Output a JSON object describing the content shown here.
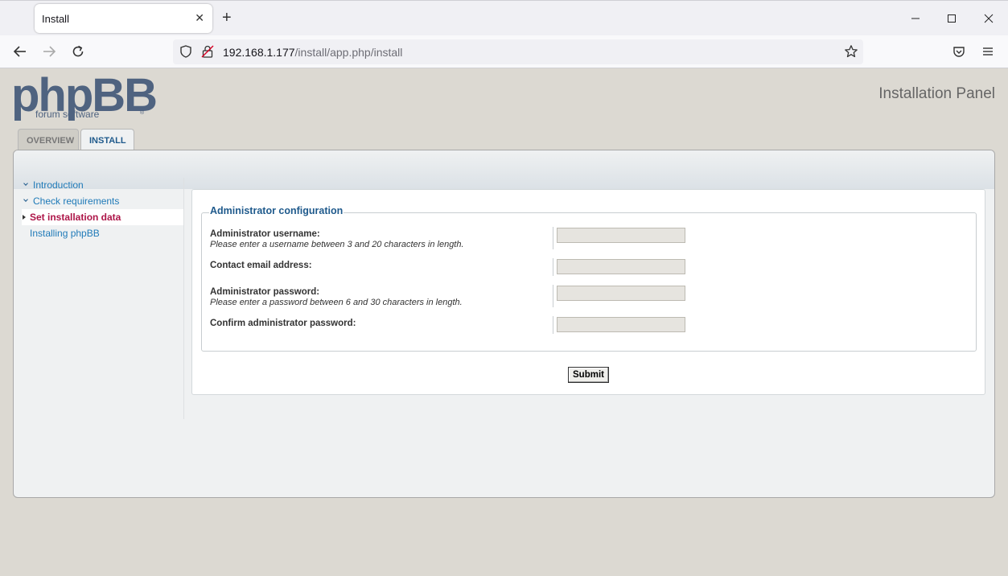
{
  "browser": {
    "tab_title": "Install",
    "tab_close": "✕",
    "new_tab": "+",
    "url_host": "192.168.1.177",
    "url_path": "/install/app.php/install"
  },
  "header": {
    "logo_main": "phpBB",
    "logo_sub": "forum software",
    "logo_reg": "®",
    "panel_title": "Installation Panel"
  },
  "tabs": [
    {
      "label": "OVERVIEW",
      "active": false
    },
    {
      "label": "INSTALL",
      "active": true
    }
  ],
  "menu": {
    "items": [
      {
        "label": "Introduction"
      },
      {
        "label": "Check requirements"
      },
      {
        "label": "Set installation data"
      },
      {
        "label": "Installing phpBB"
      }
    ]
  },
  "form": {
    "legend": "Administrator configuration",
    "fields": [
      {
        "label": "Administrator username:",
        "hint": "Please enter a username between 3 and 20 characters in length.",
        "value": ""
      },
      {
        "label": "Contact email address:",
        "hint": "",
        "value": ""
      },
      {
        "label": "Administrator password:",
        "hint": "Please enter a password between 6 and 30 characters in length.",
        "value": ""
      },
      {
        "label": "Confirm administrator password:",
        "hint": "",
        "value": ""
      }
    ],
    "submit_label": "Submit"
  },
  "colors": {
    "page_bg": "#dcd9d2",
    "link": "#1f7ab8",
    "active_item": "#ad1548",
    "heading": "#1f5a8c"
  }
}
